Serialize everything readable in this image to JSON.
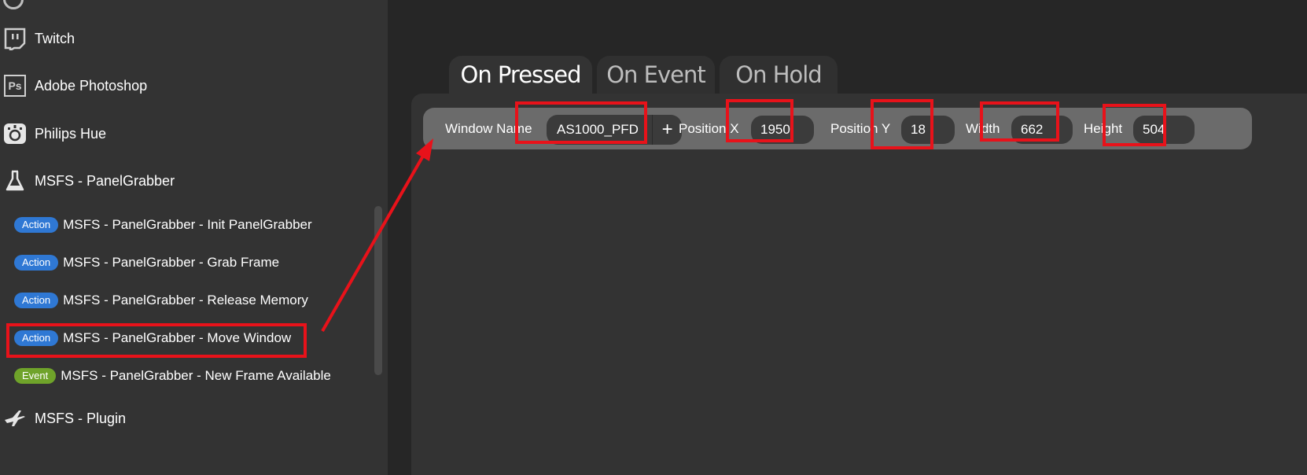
{
  "sidebar": {
    "plugins": [
      {
        "label": "Twitch",
        "icon": "twitch-icon"
      },
      {
        "label": "Adobe Photoshop",
        "icon": "photoshop-icon",
        "icon_text": "Ps"
      },
      {
        "label": "Philips Hue",
        "icon": "philips-hue-icon"
      },
      {
        "label": "MSFS - PanelGrabber",
        "icon": "flask-icon"
      },
      {
        "label": "MSFS - Plugin",
        "icon": "airplane-icon"
      }
    ],
    "actions": [
      {
        "badge": "Action",
        "label": "MSFS - PanelGrabber - Init PanelGrabber"
      },
      {
        "badge": "Action",
        "label": "MSFS - PanelGrabber - Grab Frame"
      },
      {
        "badge": "Action",
        "label": "MSFS - PanelGrabber - Release Memory"
      },
      {
        "badge": "Action",
        "label": "MSFS - PanelGrabber - Move Window"
      },
      {
        "badge": "Event",
        "label": "MSFS - PanelGrabber - New Frame Available"
      }
    ]
  },
  "tabs": [
    {
      "label": "On Pressed",
      "active": true
    },
    {
      "label": "On Event",
      "active": false
    },
    {
      "label": "On Hold",
      "active": false
    }
  ],
  "config": {
    "window_name_label": "Window Name",
    "window_name_value": "AS1000_PFD",
    "add_label": "+",
    "position_x_label": "Position X",
    "position_x_value": "1950",
    "position_y_label": "Position Y",
    "position_y_value": "18",
    "width_label": "Width",
    "width_value": "662",
    "height_label": "Height",
    "height_value": "504"
  },
  "colors": {
    "action_badge": "#2f78d4",
    "event_badge": "#6fa32a",
    "annotation": "#e8121a"
  }
}
